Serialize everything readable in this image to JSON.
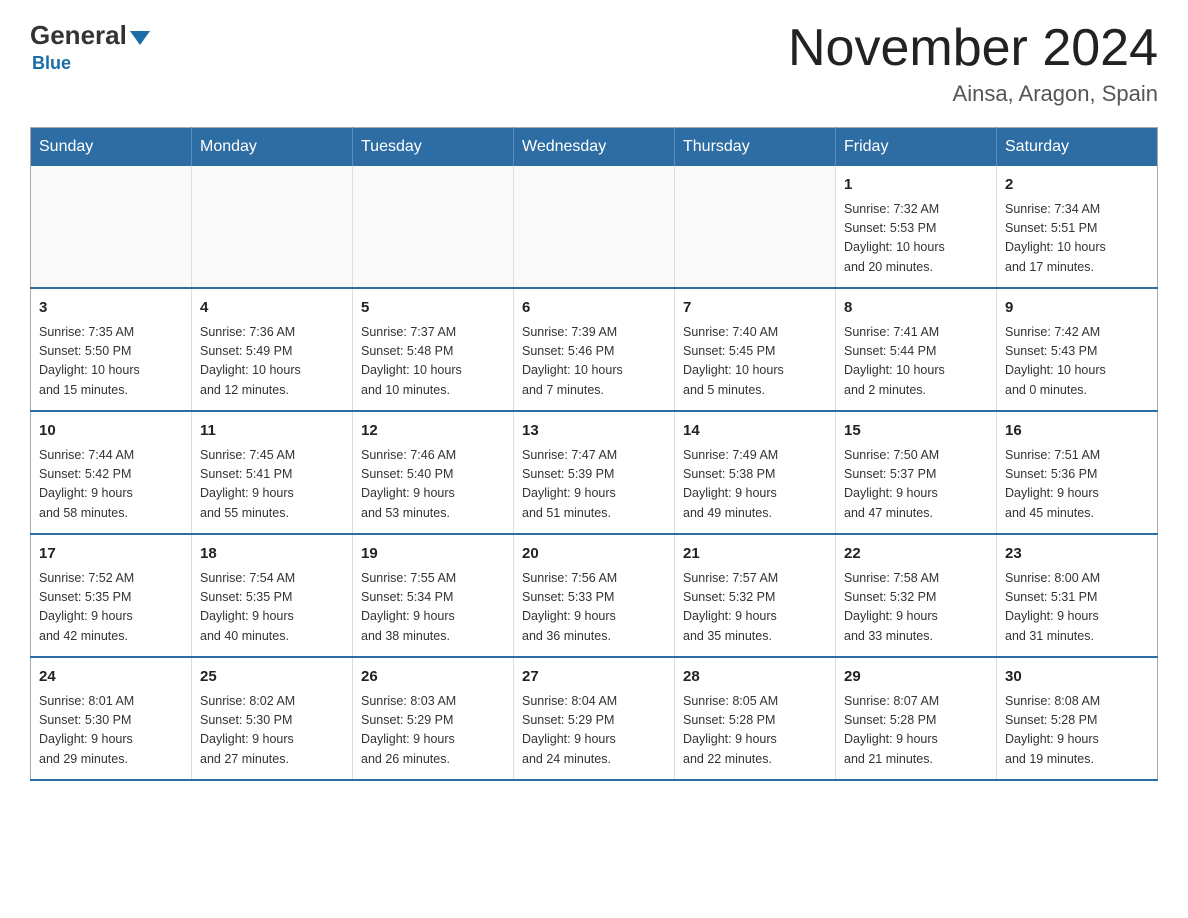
{
  "logo": {
    "general": "General",
    "blue": "Blue",
    "underline": "Blue"
  },
  "title": "November 2024",
  "subtitle": "Ainsa, Aragon, Spain",
  "weekdays": [
    "Sunday",
    "Monday",
    "Tuesday",
    "Wednesday",
    "Thursday",
    "Friday",
    "Saturday"
  ],
  "weeks": [
    [
      {
        "day": "",
        "info": ""
      },
      {
        "day": "",
        "info": ""
      },
      {
        "day": "",
        "info": ""
      },
      {
        "day": "",
        "info": ""
      },
      {
        "day": "",
        "info": ""
      },
      {
        "day": "1",
        "info": "Sunrise: 7:32 AM\nSunset: 5:53 PM\nDaylight: 10 hours\nand 20 minutes."
      },
      {
        "day": "2",
        "info": "Sunrise: 7:34 AM\nSunset: 5:51 PM\nDaylight: 10 hours\nand 17 minutes."
      }
    ],
    [
      {
        "day": "3",
        "info": "Sunrise: 7:35 AM\nSunset: 5:50 PM\nDaylight: 10 hours\nand 15 minutes."
      },
      {
        "day": "4",
        "info": "Sunrise: 7:36 AM\nSunset: 5:49 PM\nDaylight: 10 hours\nand 12 minutes."
      },
      {
        "day": "5",
        "info": "Sunrise: 7:37 AM\nSunset: 5:48 PM\nDaylight: 10 hours\nand 10 minutes."
      },
      {
        "day": "6",
        "info": "Sunrise: 7:39 AM\nSunset: 5:46 PM\nDaylight: 10 hours\nand 7 minutes."
      },
      {
        "day": "7",
        "info": "Sunrise: 7:40 AM\nSunset: 5:45 PM\nDaylight: 10 hours\nand 5 minutes."
      },
      {
        "day": "8",
        "info": "Sunrise: 7:41 AM\nSunset: 5:44 PM\nDaylight: 10 hours\nand 2 minutes."
      },
      {
        "day": "9",
        "info": "Sunrise: 7:42 AM\nSunset: 5:43 PM\nDaylight: 10 hours\nand 0 minutes."
      }
    ],
    [
      {
        "day": "10",
        "info": "Sunrise: 7:44 AM\nSunset: 5:42 PM\nDaylight: 9 hours\nand 58 minutes."
      },
      {
        "day": "11",
        "info": "Sunrise: 7:45 AM\nSunset: 5:41 PM\nDaylight: 9 hours\nand 55 minutes."
      },
      {
        "day": "12",
        "info": "Sunrise: 7:46 AM\nSunset: 5:40 PM\nDaylight: 9 hours\nand 53 minutes."
      },
      {
        "day": "13",
        "info": "Sunrise: 7:47 AM\nSunset: 5:39 PM\nDaylight: 9 hours\nand 51 minutes."
      },
      {
        "day": "14",
        "info": "Sunrise: 7:49 AM\nSunset: 5:38 PM\nDaylight: 9 hours\nand 49 minutes."
      },
      {
        "day": "15",
        "info": "Sunrise: 7:50 AM\nSunset: 5:37 PM\nDaylight: 9 hours\nand 47 minutes."
      },
      {
        "day": "16",
        "info": "Sunrise: 7:51 AM\nSunset: 5:36 PM\nDaylight: 9 hours\nand 45 minutes."
      }
    ],
    [
      {
        "day": "17",
        "info": "Sunrise: 7:52 AM\nSunset: 5:35 PM\nDaylight: 9 hours\nand 42 minutes."
      },
      {
        "day": "18",
        "info": "Sunrise: 7:54 AM\nSunset: 5:35 PM\nDaylight: 9 hours\nand 40 minutes."
      },
      {
        "day": "19",
        "info": "Sunrise: 7:55 AM\nSunset: 5:34 PM\nDaylight: 9 hours\nand 38 minutes."
      },
      {
        "day": "20",
        "info": "Sunrise: 7:56 AM\nSunset: 5:33 PM\nDaylight: 9 hours\nand 36 minutes."
      },
      {
        "day": "21",
        "info": "Sunrise: 7:57 AM\nSunset: 5:32 PM\nDaylight: 9 hours\nand 35 minutes."
      },
      {
        "day": "22",
        "info": "Sunrise: 7:58 AM\nSunset: 5:32 PM\nDaylight: 9 hours\nand 33 minutes."
      },
      {
        "day": "23",
        "info": "Sunrise: 8:00 AM\nSunset: 5:31 PM\nDaylight: 9 hours\nand 31 minutes."
      }
    ],
    [
      {
        "day": "24",
        "info": "Sunrise: 8:01 AM\nSunset: 5:30 PM\nDaylight: 9 hours\nand 29 minutes."
      },
      {
        "day": "25",
        "info": "Sunrise: 8:02 AM\nSunset: 5:30 PM\nDaylight: 9 hours\nand 27 minutes."
      },
      {
        "day": "26",
        "info": "Sunrise: 8:03 AM\nSunset: 5:29 PM\nDaylight: 9 hours\nand 26 minutes."
      },
      {
        "day": "27",
        "info": "Sunrise: 8:04 AM\nSunset: 5:29 PM\nDaylight: 9 hours\nand 24 minutes."
      },
      {
        "day": "28",
        "info": "Sunrise: 8:05 AM\nSunset: 5:28 PM\nDaylight: 9 hours\nand 22 minutes."
      },
      {
        "day": "29",
        "info": "Sunrise: 8:07 AM\nSunset: 5:28 PM\nDaylight: 9 hours\nand 21 minutes."
      },
      {
        "day": "30",
        "info": "Sunrise: 8:08 AM\nSunset: 5:28 PM\nDaylight: 9 hours\nand 19 minutes."
      }
    ]
  ]
}
